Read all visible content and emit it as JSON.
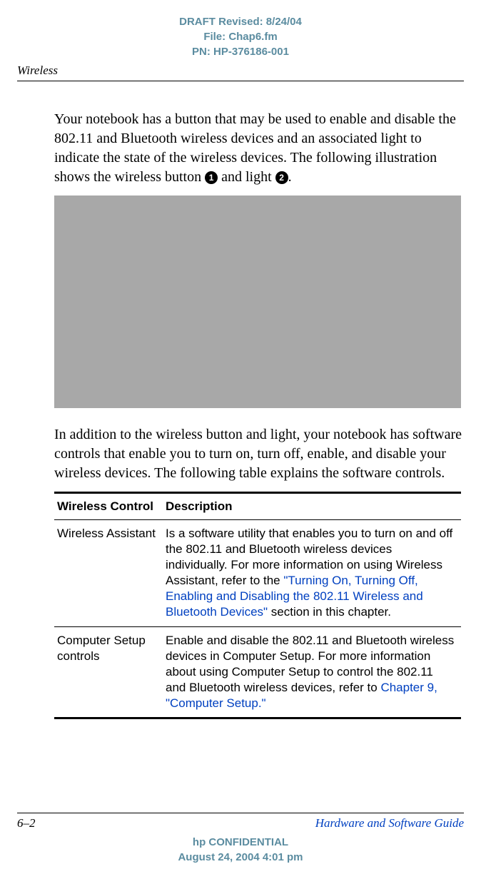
{
  "draft_header": {
    "line1": "DRAFT Revised: 8/24/04",
    "line2": "File: Chap6.fm",
    "line3": "PN: HP-376186-001"
  },
  "section_title": "Wireless",
  "paragraphs": {
    "p1_a": "Your notebook has a button that may be used to enable and disable the 802.11 and Bluetooth wireless devices and an associated light to indicate the state of the wireless devices. The following illustration shows the wireless button ",
    "p1_mark1": "1",
    "p1_b": " and light ",
    "p1_mark2": "2",
    "p1_c": ".",
    "p2": "In addition to the wireless button and light, your notebook has software controls that enable you to turn on, turn off, enable, and disable your wireless devices. The following table explains the software controls."
  },
  "table": {
    "headers": {
      "col1": "Wireless Control",
      "col2": "Description"
    },
    "rows": [
      {
        "col1": "Wireless Assistant",
        "col2_a": "Is a software utility that enables you to turn on and off the 802.11 and Bluetooth wireless devices individually. For more information on using Wireless Assistant, refer to the ",
        "col2_link": "\"Turning On, Turning Off, Enabling and Disabling the 802.11 Wireless and Bluetooth Devices\"",
        "col2_b": " section in this chapter."
      },
      {
        "col1": "Computer Setup controls",
        "col2_a": "Enable and disable the 802.11 and Bluetooth wireless devices in Computer Setup. For more information about using Computer Setup to control the 802.11 and Bluetooth wireless devices, refer to ",
        "col2_link": "Chapter 9, \"Computer Setup.\"",
        "col2_b": ""
      }
    ]
  },
  "footer": {
    "page_num": "6–2",
    "guide_title": "Hardware and Software Guide",
    "conf_line1": "hp CONFIDENTIAL",
    "conf_line2": "August 24, 2004 4:01 pm"
  }
}
